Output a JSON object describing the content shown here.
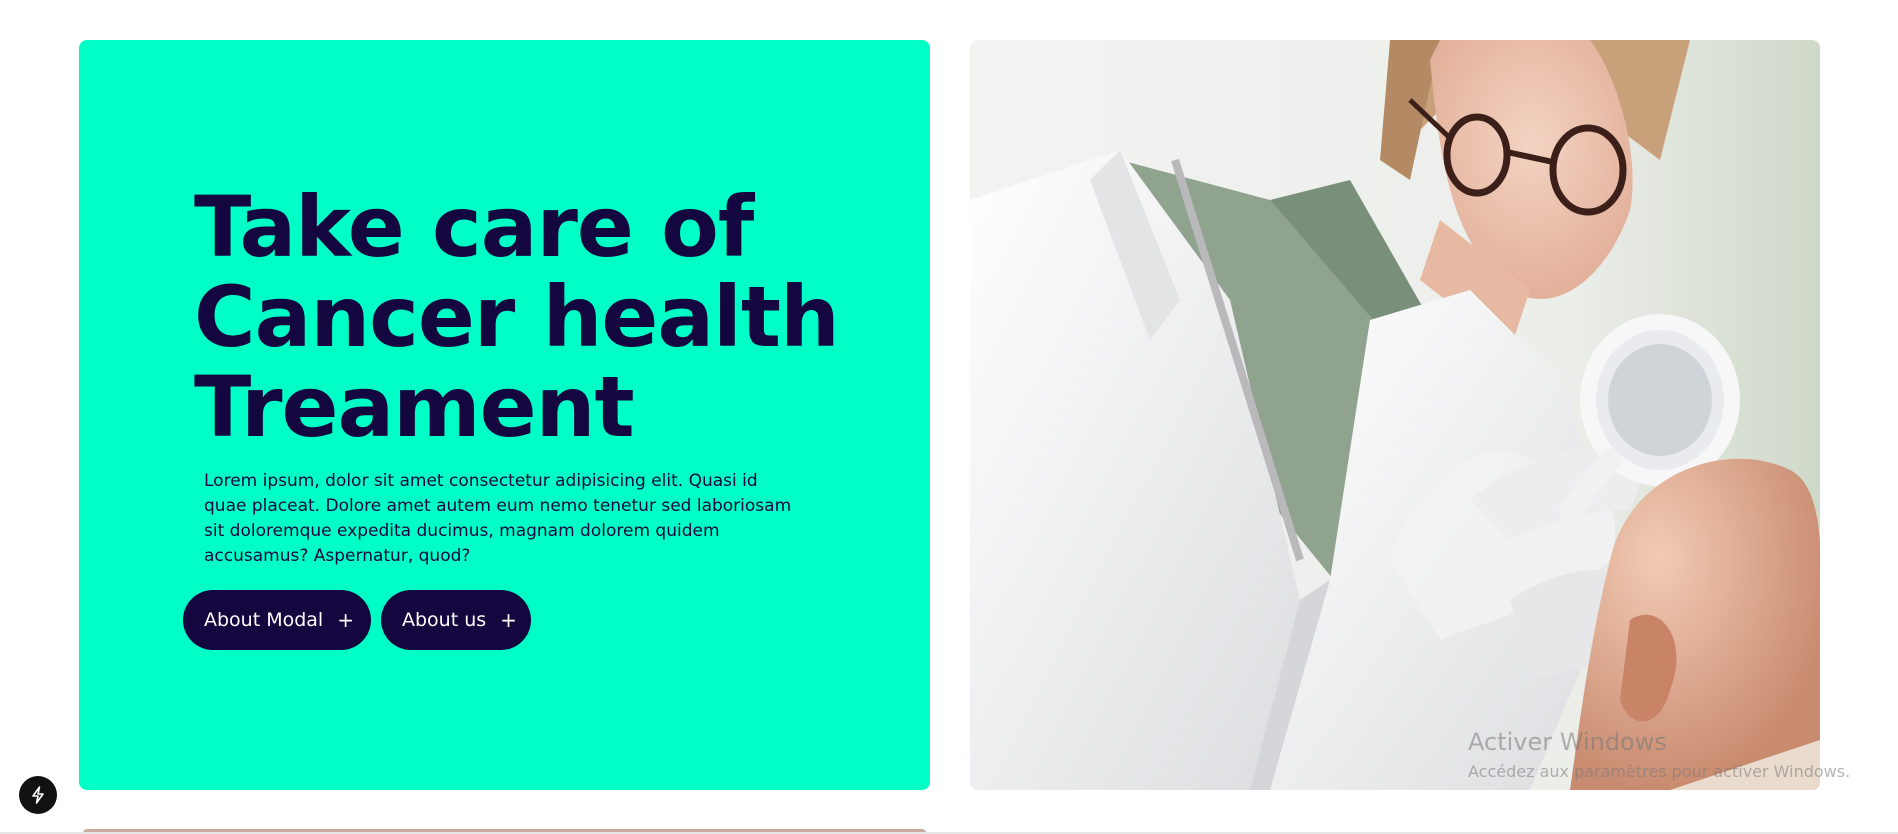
{
  "hero": {
    "title_lines": [
      "Take care of",
      "Cancer health",
      "Treament"
    ],
    "description": "Lorem ipsum, dolor sit amet consectetur adipisicing elit. Quasi id quae placeat. Dolore amet autem eum nemo tenetur sed laboriosam sit doloremque expedita ducimus, magnam dolorem quidem accusamus? Aspernatur, quod?",
    "buttons": [
      {
        "label": "About Modal",
        "icon": "plus-icon",
        "icon_glyph": "+"
      },
      {
        "label": "About us",
        "icon": "plus-icon",
        "icon_glyph": "+"
      }
    ]
  },
  "image": {
    "subject": "doctor-examining-patient-scalp-with-magnifier"
  },
  "watermark": {
    "title": "Activer Windows",
    "subtitle": "Accédez aux paramètres pour activer Windows."
  },
  "badge": {
    "icon": "lightning-icon"
  },
  "colors": {
    "hero_bg": "#00ffc6",
    "brand_dark": "#14063e",
    "page_bg": "#ffffff",
    "badge_bg": "#111111"
  }
}
